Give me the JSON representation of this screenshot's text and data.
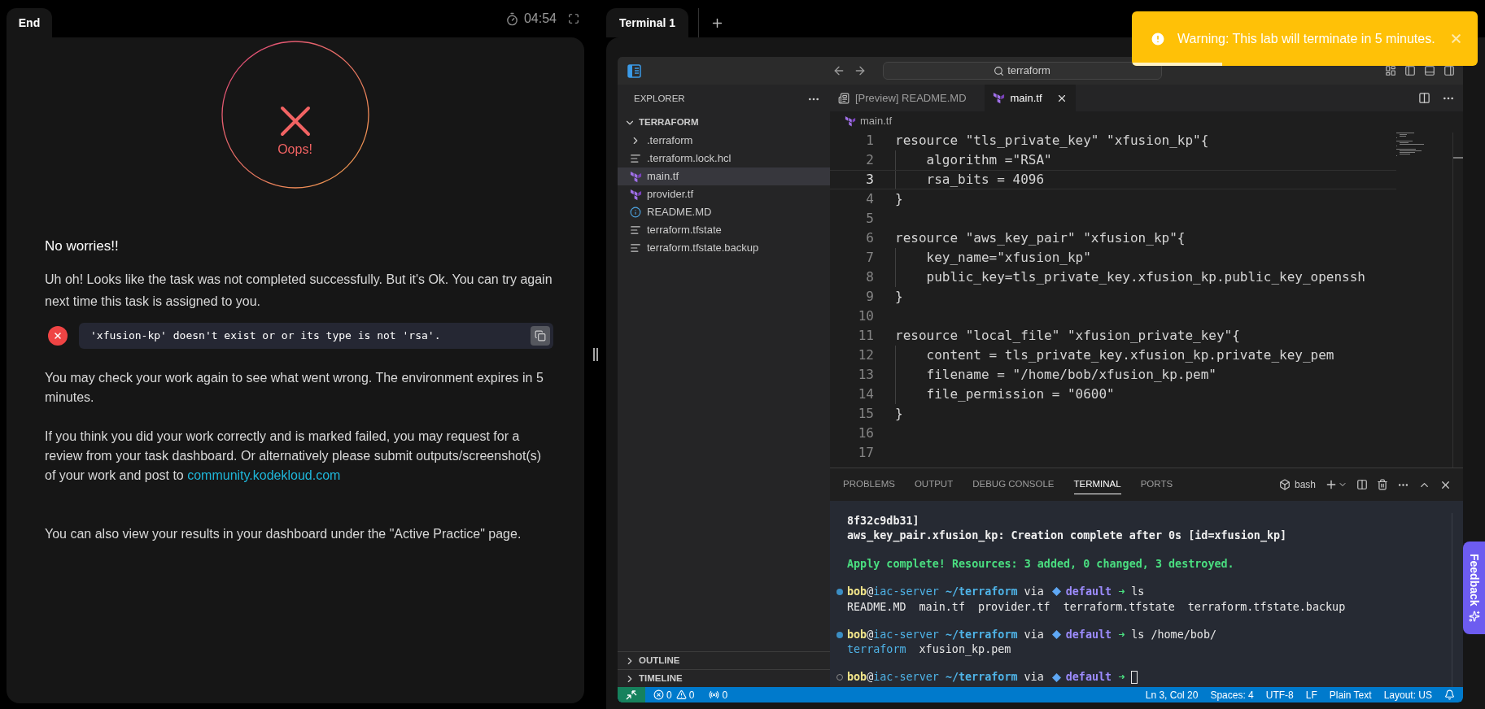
{
  "lab": {
    "tab": "End",
    "timer": "04:54",
    "result": {
      "failed": true,
      "label": "Oops!"
    },
    "heading": "No worries!!",
    "intro": "Uh oh! Looks like the task was not completed successfully. But it's Ok. You can try again next time this task is assigned to you.",
    "error": "'xfusion-kp' doesn't exist or or its type is not 'rsa'.",
    "paragraphs": [
      {
        "text": "You may check your work again to see what went wrong. The environment expires in 5 minutes."
      },
      {
        "text": "If you think you did your work correctly and is marked failed, you may request for a review from your task dashboard. Or alternatively please submit outputs/screenshot(s) of your work and post to ",
        "link": "community.kodekloud.com"
      },
      {
        "text": "You can also view your results in your dashboard under the \"Active Practice\" page."
      }
    ]
  },
  "terminal_tabs": [
    {
      "label": "Terminal 1",
      "selected": true
    }
  ],
  "toast": {
    "kind": "warning",
    "message": "Warning: This lab will terminate in 5 minutes.",
    "level": 0.26
  },
  "feedback": "Feedback",
  "vscode": {
    "search": "terraform",
    "explorer": {
      "title": "EXPLORER",
      "folder": {
        "label": "TERRAFORM",
        "expanded": true,
        "children": [
          {
            "label": ".terraform",
            "kind": "folder",
            "expanded": false,
            "selected": false
          },
          {
            "label": ".terraform.lock.hcl",
            "kind": "text",
            "selected": false
          },
          {
            "label": "main.tf",
            "kind": "terraform",
            "selected": true
          },
          {
            "label": "provider.tf",
            "kind": "terraform",
            "selected": false
          },
          {
            "label": "README.MD",
            "kind": "info",
            "selected": false
          },
          {
            "label": "terraform.tfstate",
            "kind": "text",
            "selected": false
          },
          {
            "label": "terraform.tfstate.backup",
            "kind": "text",
            "selected": false
          }
        ]
      },
      "sections": [
        {
          "label": "OUTLINE",
          "expanded": false
        },
        {
          "label": "TIMELINE",
          "expanded": false
        }
      ]
    },
    "editor_tabs": [
      {
        "label": "[Preview] README.MD",
        "kind": "preview",
        "selected": false
      },
      {
        "label": "main.tf",
        "kind": "terraform",
        "selected": true
      }
    ],
    "breadcrumb": "main.tf",
    "code": [
      {
        "number": "1",
        "text": "resource \"tls_private_key\" \"xfusion_kp\"{",
        "current": false
      },
      {
        "number": "2",
        "text": "    algorithm =\"RSA\"",
        "current": false
      },
      {
        "number": "3",
        "text": "    rsa_bits = 4096",
        "current": true
      },
      {
        "number": "4",
        "text": "}",
        "current": false
      },
      {
        "number": "5",
        "current": false
      },
      {
        "number": "6",
        "text": "resource \"aws_key_pair\" \"xfusion_kp\"{",
        "current": false
      },
      {
        "number": "7",
        "text": "    key_name=\"xfusion_kp\"",
        "current": false
      },
      {
        "number": "8",
        "text": "    public_key=tls_private_key.xfusion_kp.public_key_openssh",
        "current": false
      },
      {
        "number": "9",
        "text": "}",
        "current": false
      },
      {
        "number": "10",
        "current": false
      },
      {
        "number": "11",
        "text": "resource \"local_file\" \"xfusion_private_key\"{",
        "current": false
      },
      {
        "number": "12",
        "text": "    content = tls_private_key.xfusion_kp.private_key_pem",
        "current": false
      },
      {
        "number": "13",
        "text": "    filename = \"/home/bob/xfusion_kp.pem\"",
        "current": false
      },
      {
        "number": "14",
        "text": "    file_permission = \"0600\"",
        "current": false
      },
      {
        "number": "15",
        "text": "}",
        "current": false
      },
      {
        "number": "16",
        "current": false
      },
      {
        "number": "17",
        "current": false
      }
    ],
    "panel_tabs": [
      {
        "label": "PROBLEMS",
        "selected": false
      },
      {
        "label": "OUTPUT",
        "selected": false
      },
      {
        "label": "DEBUG CONSOLE",
        "selected": false
      },
      {
        "label": "TERMINAL",
        "selected": true
      },
      {
        "label": "PORTS",
        "selected": false
      }
    ],
    "shell": "bash",
    "terminal": [
      [
        {
          "kind": "output",
          "text": "8f32c9db31]"
        },
        {
          "kind": "output",
          "text": "aws_key_pair.xfusion_kp: Creation complete after 0s [id=xfusion_kp]"
        }
      ],
      [
        {
          "kind": "success",
          "text": "Apply complete! Resources: 3 added, 0 changed, 3 destroyed."
        }
      ],
      [
        {
          "kind": "prompt",
          "finished": true,
          "cursor": false,
          "user": "bob",
          "at": "@",
          "host": "iac-server",
          "path": "~/terraform",
          "via": "via",
          "env": "default",
          "arrow": "➜",
          "command": "ls"
        },
        {
          "kind": "listing",
          "entries": [
            {
              "name": "README.MD",
              "kind": "file"
            },
            {
              "name": "main.tf",
              "kind": "file"
            },
            {
              "name": "provider.tf",
              "kind": "file"
            },
            {
              "name": "terraform.tfstate",
              "kind": "file"
            },
            {
              "name": "terraform.tfstate.backup",
              "kind": "file"
            }
          ]
        }
      ],
      [
        {
          "kind": "prompt",
          "finished": true,
          "cursor": false,
          "user": "bob",
          "at": "@",
          "host": "iac-server",
          "path": "~/terraform",
          "via": "via",
          "env": "default",
          "arrow": "➜",
          "command": "ls /home/bob/"
        },
        {
          "kind": "listing",
          "entries": [
            {
              "name": "terraform",
              "kind": "dir"
            },
            {
              "name": "xfusion_kp.pem",
              "kind": "file"
            }
          ]
        }
      ],
      [
        {
          "kind": "prompt",
          "finished": false,
          "cursor": true,
          "user": "bob",
          "at": "@",
          "host": "iac-server",
          "path": "~/terraform",
          "via": "via",
          "env": "default",
          "arrow": "➜"
        }
      ]
    ],
    "status": {
      "errors": "0",
      "warnings": "0",
      "ports": "0",
      "items": [
        "Ln 3, Col 20",
        "Spaces: 4",
        "UTF-8",
        "LF",
        "Plain Text",
        "Layout: US"
      ]
    }
  }
}
